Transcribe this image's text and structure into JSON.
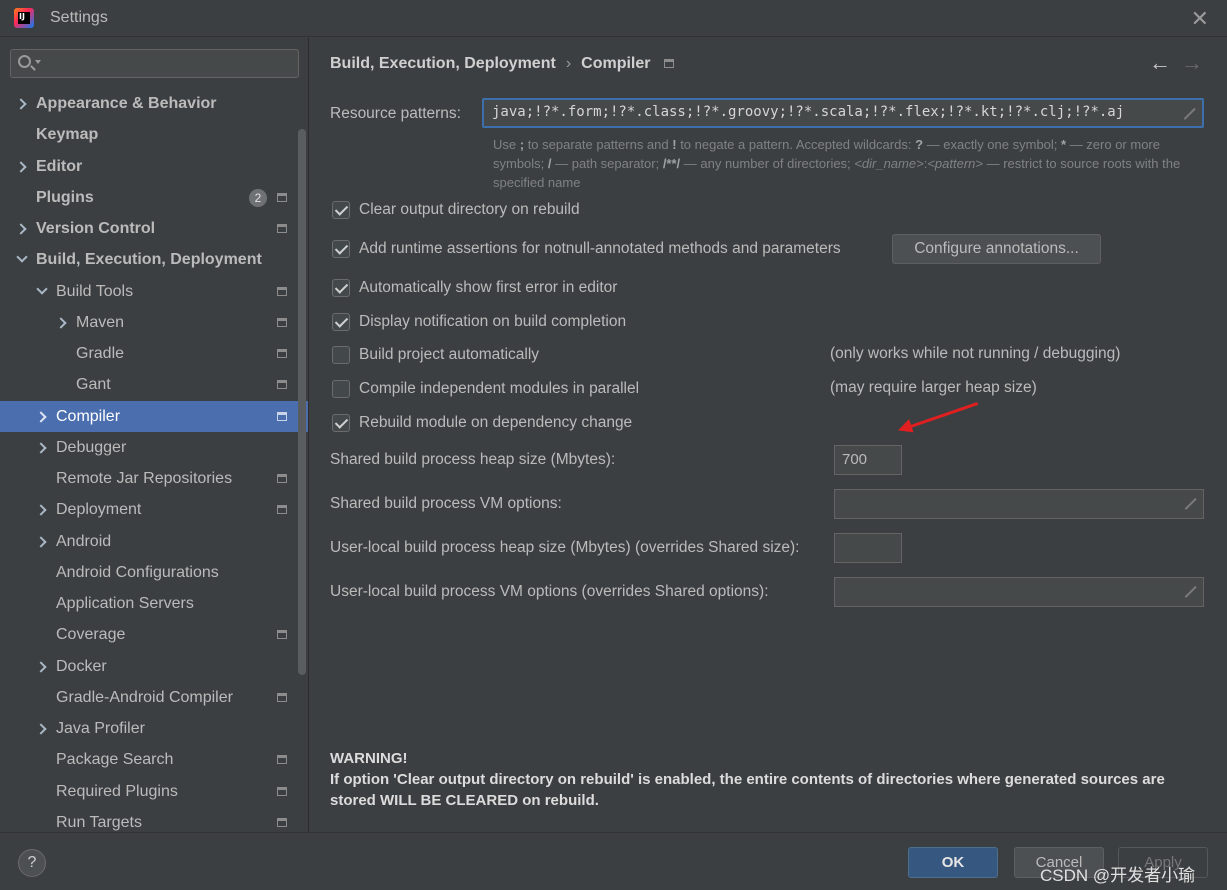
{
  "window": {
    "title": "Settings",
    "app_icon_letters": "IJ"
  },
  "search": {
    "placeholder": ""
  },
  "sidebar": {
    "items": [
      {
        "label": "Appearance & Behavior"
      },
      {
        "label": "Keymap"
      },
      {
        "label": "Editor"
      },
      {
        "label": "Plugins",
        "badge": "2"
      },
      {
        "label": "Version Control"
      },
      {
        "label": "Build, Execution, Deployment"
      },
      {
        "label": "Build Tools"
      },
      {
        "label": "Maven"
      },
      {
        "label": "Gradle"
      },
      {
        "label": "Gant"
      },
      {
        "label": "Compiler"
      },
      {
        "label": "Debugger"
      },
      {
        "label": "Remote Jar Repositories"
      },
      {
        "label": "Deployment"
      },
      {
        "label": "Android"
      },
      {
        "label": "Android Configurations"
      },
      {
        "label": "Application Servers"
      },
      {
        "label": "Coverage"
      },
      {
        "label": "Docker"
      },
      {
        "label": "Gradle-Android Compiler"
      },
      {
        "label": "Java Profiler"
      },
      {
        "label": "Package Search"
      },
      {
        "label": "Required Plugins"
      },
      {
        "label": "Run Targets"
      }
    ]
  },
  "breadcrumb": {
    "parent": "Build, Execution, Deployment",
    "separator": "›",
    "current": "Compiler"
  },
  "nav": {
    "back": "←",
    "forward": "→"
  },
  "compiler": {
    "resource_patterns_label": "Resource patterns:",
    "resource_patterns_value": "java;!?*.form;!?*.class;!?*.groovy;!?*.scala;!?*.flex;!?*.kt;!?*.clj;!?*.aj",
    "hint": {
      "p1": "Use ",
      "k1": ";",
      "p2": " to separate patterns and ",
      "k2": "!",
      "p3": " to negate a pattern. Accepted wildcards: ",
      "k3": "?",
      "p4": " — exactly one symbol; ",
      "k4": "*",
      "p5": " — zero or more symbols; ",
      "k5": "/",
      "p6": " — path separator; ",
      "k6": "/**/",
      "p7": " — any number of directories; ",
      "k7": "<dir_name>",
      "p8": ":",
      "k8": "<pattern>",
      "p9": " — restrict to source roots with the specified name"
    },
    "options": [
      {
        "label": "Clear output directory on rebuild",
        "checked": true
      },
      {
        "label": "Add runtime assertions for notnull-annotated methods and parameters",
        "checked": true
      },
      {
        "label": "Automatically show first error in editor",
        "checked": true
      },
      {
        "label": "Display notification on build completion",
        "checked": true
      },
      {
        "label": "Build project automatically",
        "checked": false,
        "note": "(only works while not running / debugging)"
      },
      {
        "label": "Compile independent modules in parallel",
        "checked": false,
        "note": "(may require larger heap size)"
      },
      {
        "label": "Rebuild module on dependency change",
        "checked": true
      }
    ],
    "configure_annotations_label": "Configure annotations...",
    "shared_heap_label": "Shared build process heap size (Mbytes):",
    "shared_heap_value": "700",
    "shared_vm_label": "Shared build process VM options:",
    "shared_vm_value": "",
    "user_heap_label": "User-local build process heap size (Mbytes) (overrides Shared size):",
    "user_heap_value": "",
    "user_vm_label": "User-local build process VM options (overrides Shared options):",
    "user_vm_value": ""
  },
  "warning": {
    "title": "WARNING!",
    "text": "If option 'Clear output directory on rebuild' is enabled, the entire contents of directories where generated sources are stored WILL BE CLEARED on rebuild."
  },
  "footer": {
    "help": "?",
    "ok": "OK",
    "cancel": "Cancel",
    "apply": "Apply"
  },
  "watermark": "CSDN @开发者小瑜",
  "colors": {
    "selection": "#4b6eaf",
    "background": "#3c3f41",
    "ok_button": "#365880",
    "annotation_arrow": "#e02020"
  }
}
